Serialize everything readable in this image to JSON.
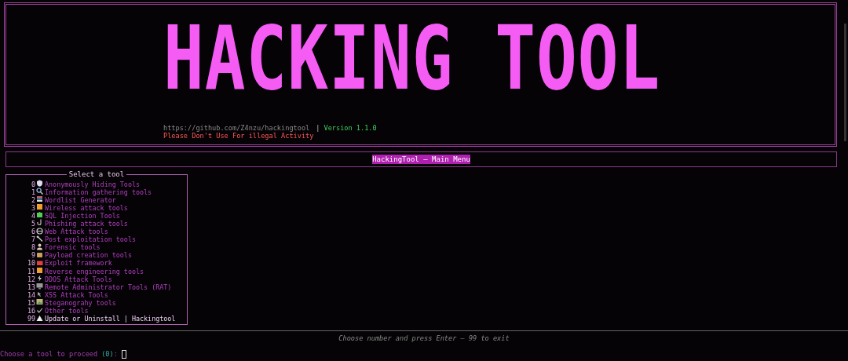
{
  "banner": {
    "title": "HACKING TOOL",
    "url": "https://github.com/Z4nzu/hackingtool",
    "separator": "|",
    "version": "Version 1.1.0",
    "warning": "Please Don't Use For illegal Activity"
  },
  "menu_title": "HackingTool — Main Menu",
  "tool_list": {
    "title": "Select a tool",
    "items": [
      {
        "number": "0",
        "kind": "shield",
        "label": "Anonymously Hiding Tools",
        "emphasized": false
      },
      {
        "number": "1",
        "kind": "magnifier",
        "label": "Information gathering tools",
        "emphasized": false
      },
      {
        "number": "2",
        "kind": "books",
        "label": "Wordlist Generator",
        "emphasized": false
      },
      {
        "number": "3",
        "kind": "square",
        "label": "Wireless attack tools",
        "emphasized": false
      },
      {
        "number": "4",
        "kind": "puzzle",
        "label": "SQL Injection Tools",
        "emphasized": false
      },
      {
        "number": "5",
        "kind": "hook",
        "label": "Phishing attack tools",
        "emphasized": false
      },
      {
        "number": "6",
        "kind": "globe",
        "label": "Web Attack tools",
        "emphasized": false
      },
      {
        "number": "7",
        "kind": "wrench",
        "label": "Post exploitation tools",
        "emphasized": false
      },
      {
        "number": "8",
        "kind": "person",
        "label": "Forensic tools",
        "emphasized": false
      },
      {
        "number": "9",
        "kind": "package",
        "label": "Payload creation tools",
        "emphasized": false
      },
      {
        "number": "10",
        "kind": "toolbox",
        "label": "Exploit framework",
        "emphasized": false
      },
      {
        "number": "11",
        "kind": "square",
        "label": "Reverse engineering tools",
        "emphasized": false
      },
      {
        "number": "12",
        "kind": "lightning",
        "label": "DDOS Attack Tools",
        "emphasized": false
      },
      {
        "number": "13",
        "kind": "monitor",
        "label": "Remote Administrator Tools (RAT)",
        "emphasized": false
      },
      {
        "number": "14",
        "kind": "pointer",
        "label": "XSS Attack Tools",
        "emphasized": false
      },
      {
        "number": "15",
        "kind": "picture",
        "label": "Steganograhy tools",
        "emphasized": false
      },
      {
        "number": "16",
        "kind": "check",
        "label": "Other tools",
        "emphasized": false
      },
      {
        "number": "99",
        "kind": "warning",
        "label": "Update or Uninstall | Hackingtool",
        "emphasized": true
      }
    ]
  },
  "hint": "Choose number and press Enter — 99 to exit",
  "prompt": {
    "text": "Choose a tool to proceed",
    "default": "(0)",
    "colon": ":"
  }
}
